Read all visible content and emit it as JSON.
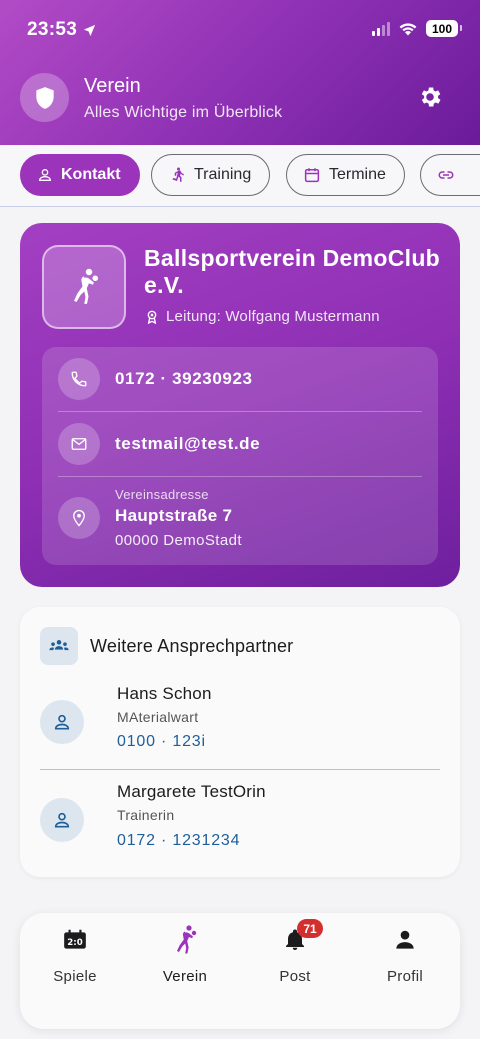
{
  "status_bar": {
    "time": "23:53",
    "battery": "100"
  },
  "header": {
    "title": "Verein",
    "subtitle": "Alles Wichtige im Überblick"
  },
  "tabs": [
    {
      "label": "Kontakt",
      "icon": "person-icon"
    },
    {
      "label": "Training",
      "icon": "running-icon"
    },
    {
      "label": "Termine",
      "icon": "calendar-icon"
    },
    {
      "label": "",
      "icon": "link-icon"
    }
  ],
  "club": {
    "name": "Ballsportverein DemoClub e.V.",
    "leader": "Leitung: Wolfgang Mustermann",
    "phone": "0172 · 39230923",
    "email": "testmail@test.de",
    "address_label": "Vereinsadresse",
    "street": "Hauptstraße 7",
    "city": "00000 DemoStadt"
  },
  "contacts": {
    "title": "Weitere Ansprechpartner",
    "people": [
      {
        "name": "Hans Schon",
        "role": "MAterialwart",
        "phone": "0100 · 123i"
      },
      {
        "name": "Margarete TestOrin",
        "role": "Trainerin",
        "phone": "0172 · 1231234"
      }
    ]
  },
  "nav": {
    "items": [
      {
        "label": "Spiele",
        "icon": "scoreboard-icon"
      },
      {
        "label": "Verein",
        "icon": "handball-icon"
      },
      {
        "label": "Post",
        "icon": "bell-icon",
        "badge": "71"
      },
      {
        "label": "Profil",
        "icon": "person-icon"
      }
    ],
    "active": "Verein"
  },
  "colors": {
    "accent": "#9c34bb",
    "link": "#1e5f99",
    "badge": "#d32f2f"
  }
}
